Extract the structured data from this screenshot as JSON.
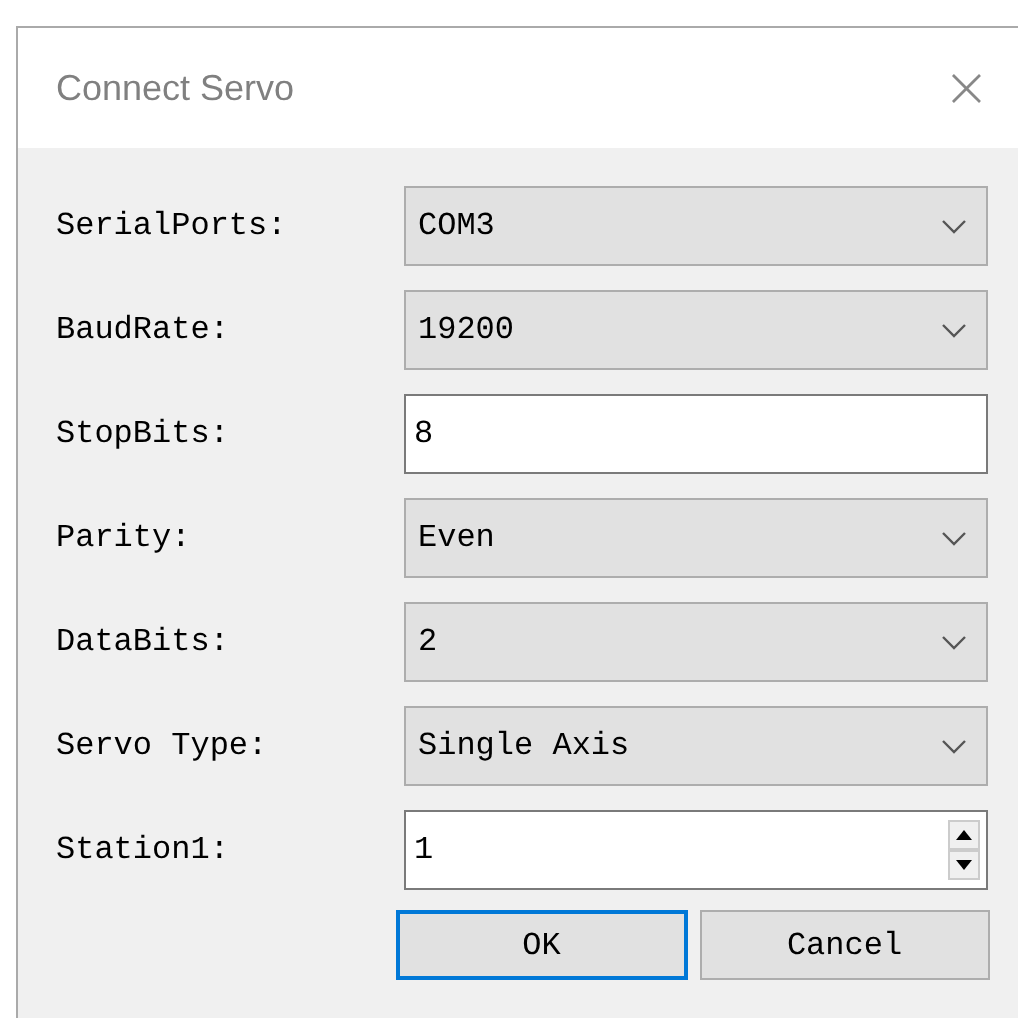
{
  "window": {
    "title": "Connect Servo",
    "close": "×"
  },
  "fields": [
    {
      "label": "SerialPorts:",
      "kind": "combo",
      "value": "COM3"
    },
    {
      "label": "BaudRate:",
      "kind": "combo",
      "value": "19200"
    },
    {
      "label": "StopBits:",
      "kind": "text",
      "value": "8"
    },
    {
      "label": "Parity:",
      "kind": "combo",
      "value": "Even"
    },
    {
      "label": "DataBits:",
      "kind": "combo",
      "value": "2"
    },
    {
      "label": "Servo Type:",
      "kind": "combo",
      "value": "Single Axis"
    },
    {
      "label": "Station1:",
      "kind": "spin",
      "value": "1"
    }
  ],
  "buttons": [
    {
      "label": "OK",
      "focused": true
    },
    {
      "label": "Cancel",
      "focused": false
    }
  ]
}
